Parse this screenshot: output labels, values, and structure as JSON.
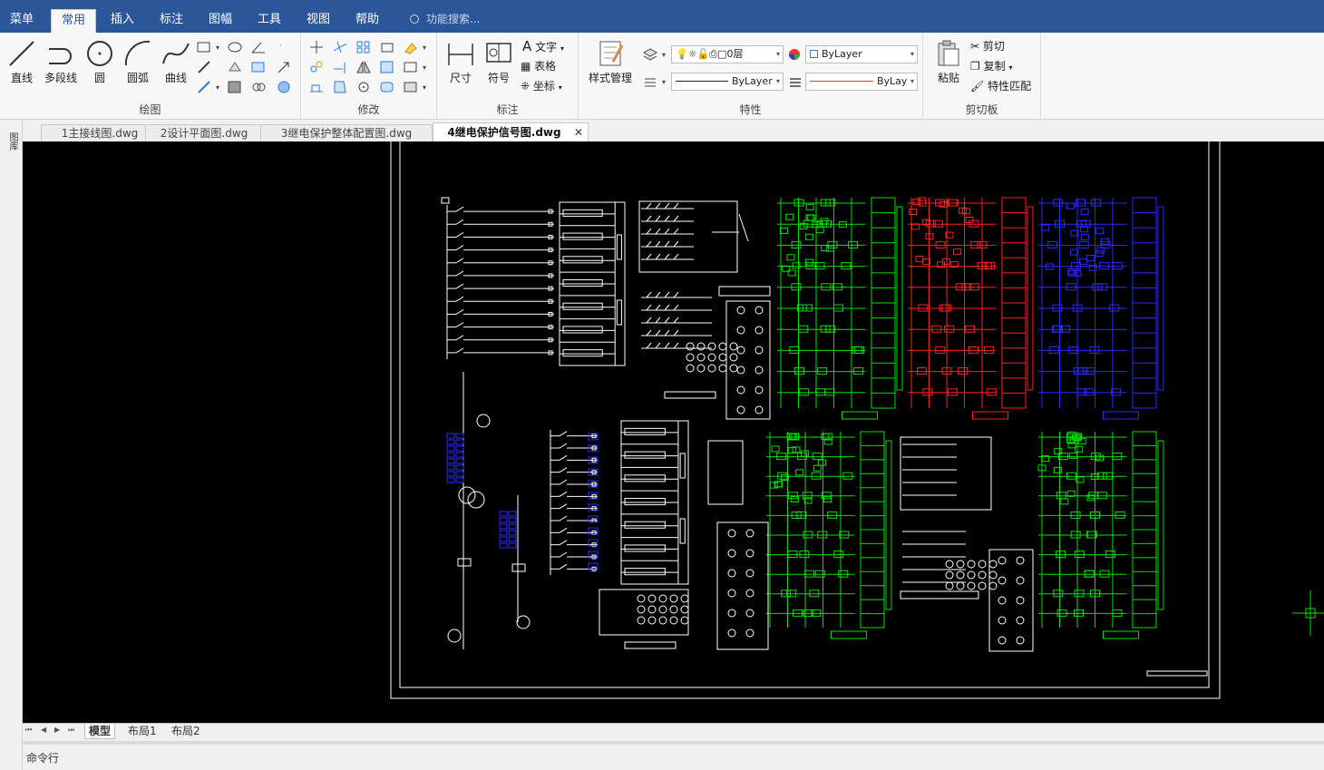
{
  "menubar": {
    "tabs": [
      "菜单",
      "常用",
      "插入",
      "标注",
      "图幅",
      "工具",
      "视图",
      "帮助"
    ],
    "active_index": 1,
    "search_placeholder": "功能搜索..."
  },
  "ribbon": {
    "draw": {
      "label": "绘图",
      "buttons": [
        "直线",
        "多段线",
        "圆",
        "圆弧",
        "曲线"
      ]
    },
    "modify": {
      "label": "修改"
    },
    "annotate": {
      "label": "标注",
      "buttons": [
        "尺寸",
        "符号"
      ],
      "small": [
        "文字",
        "表格",
        "坐标"
      ]
    },
    "properties": {
      "label": "特性",
      "style_button": "样式管理",
      "layer_value": "0层",
      "color_value": "ByLayer",
      "linetype_value": "ByLayer",
      "lineweight_value": "ByLay"
    },
    "clipboard": {
      "label": "剪切板",
      "paste": "粘贴",
      "cut": "剪切",
      "copy": "复制",
      "match": "特性匹配"
    }
  },
  "leftstrip": {
    "label": "图库"
  },
  "doctabs": [
    {
      "label": "1主接线图.dwg",
      "active": false
    },
    {
      "label": "2设计平面图.dwg",
      "active": false
    },
    {
      "label": "3继电保护整体配置图.dwg",
      "active": false
    },
    {
      "label": "4继电保护信号图.dwg",
      "active": true
    }
  ],
  "layouttabs": [
    "模型",
    "布局1",
    "布局2"
  ],
  "cmdline": {
    "label": "命令行"
  },
  "colors": {
    "accent": "#2b579a",
    "canvas": "#000000",
    "white_line": "#ffffff",
    "green_line": "#00e000",
    "red_line": "#ff2020",
    "blue_line": "#2a2aff"
  }
}
